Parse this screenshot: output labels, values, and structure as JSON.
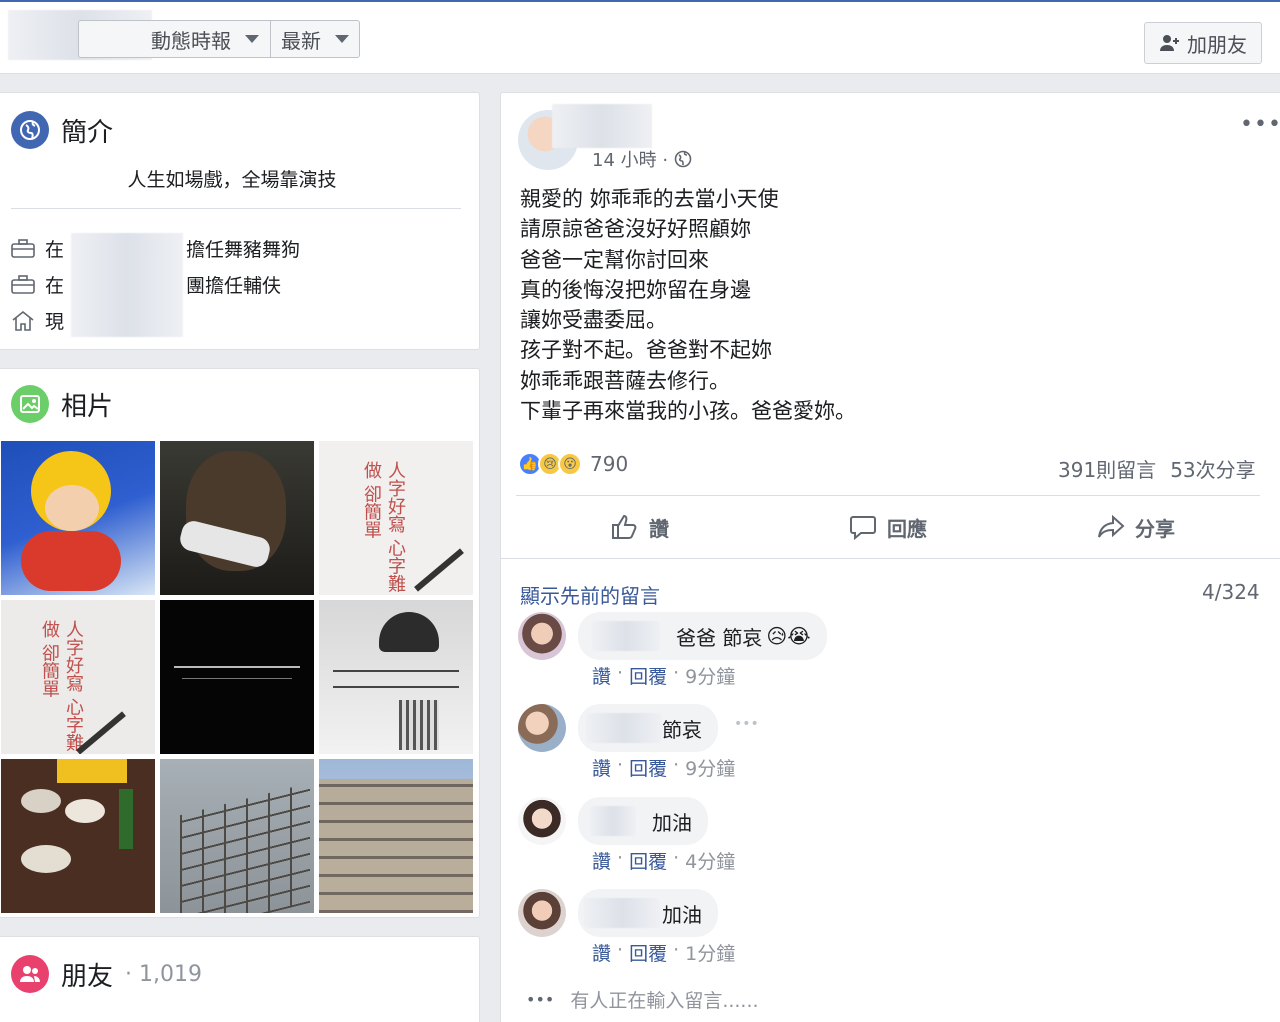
{
  "topbar": {
    "timeline_label": "動態時報",
    "sort_label": "最新",
    "add_friend_label": "加朋友"
  },
  "intro": {
    "title": "簡介",
    "bio": "人生如場戲，全場靠演技",
    "work1_prefix": "在",
    "work1_suffix": "擔任舞豬舞狗",
    "work2_prefix": "在",
    "work2_suffix": "團擔任輔伕",
    "lives_prefix": "現"
  },
  "photos": {
    "title": "相片"
  },
  "friends": {
    "title": "朋友",
    "count": "· 1,019"
  },
  "post": {
    "time": "14 小時 ·",
    "lines": [
      "親愛的 妳乖乖的去當小天使",
      "請原諒爸爸沒好好照顧妳",
      "爸爸一定幫你討回來",
      "真的後悔沒把妳留在身邊",
      "讓妳受盡委屈。",
      "孩子對不起。爸爸對不起妳",
      "妳乖乖跟菩薩去修行。",
      "下輩子再來當我的小孩。爸爸愛妳。"
    ],
    "reaction_count": "790",
    "comments_count": "391則留言",
    "shares_count": "53次分享",
    "like_label": "讚",
    "comment_label": "回應",
    "share_label": "分享"
  },
  "comments_section": {
    "show_previous": "顯示先前的留言",
    "counter": "4/324",
    "comments": [
      {
        "text": "爸爸 節哀",
        "emoji": "😥😭",
        "time": "9分鐘"
      },
      {
        "text": "節哀",
        "emoji": "",
        "time": "9分鐘"
      },
      {
        "text": "加油",
        "emoji": "",
        "time": "4分鐘"
      },
      {
        "text": "加油",
        "emoji": "",
        "time": "1分鐘"
      }
    ],
    "like": "讚",
    "reply": "回覆",
    "dot": "·",
    "typing": "有人正在輸入留言......"
  }
}
